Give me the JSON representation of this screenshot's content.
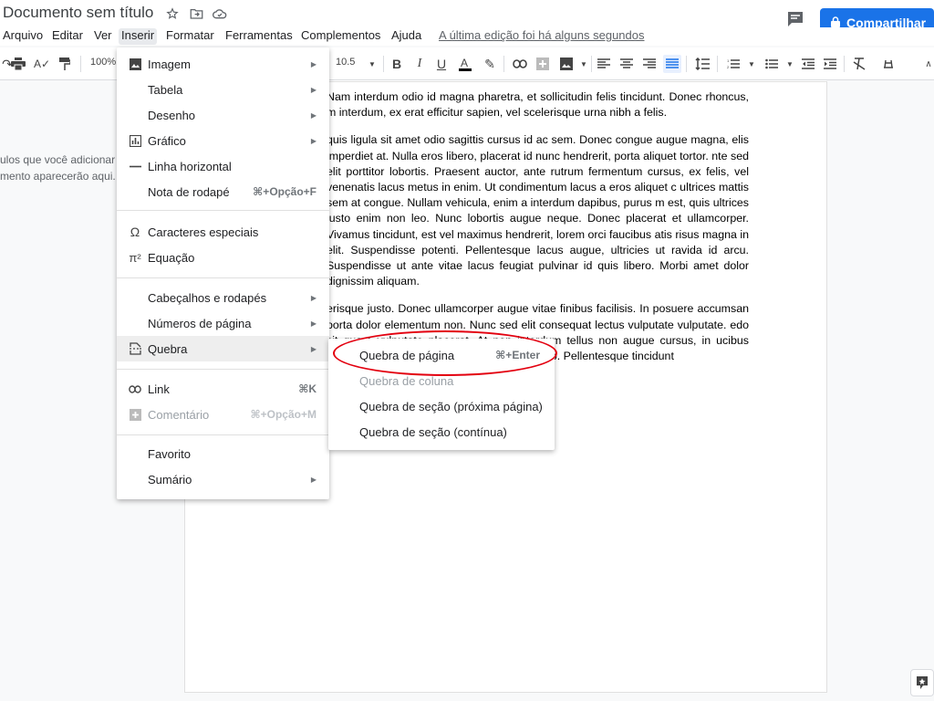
{
  "titlebar": {
    "doc_title": "Documento sem título",
    "share_label": "Compartilhar"
  },
  "menubar": {
    "items": [
      "Arquivo",
      "Editar",
      "Ver",
      "Inserir",
      "Formatar",
      "Ferramentas",
      "Complementos",
      "Ajuda"
    ],
    "active": "Inserir",
    "last_edit": "A última edição foi há alguns segundos"
  },
  "toolbar": {
    "zoom": "100%",
    "font_size": "10.5"
  },
  "outline": {
    "line1": "ulos que você adicionar a",
    "line2": "mento aparecerão aqui."
  },
  "insert_menu": {
    "items": [
      {
        "label": "Imagem",
        "icon": "image-icon",
        "shortcut": "",
        "submenu": true,
        "disabled": false
      },
      {
        "label": "Tabela",
        "icon": "",
        "shortcut": "",
        "submenu": true,
        "disabled": false
      },
      {
        "label": "Desenho",
        "icon": "",
        "shortcut": "",
        "submenu": true,
        "disabled": false
      },
      {
        "label": "Gráfico",
        "icon": "chart-icon",
        "shortcut": "",
        "submenu": true,
        "disabled": false
      },
      {
        "label": "Linha horizontal",
        "icon": "horizontal-line-icon",
        "shortcut": "",
        "submenu": false,
        "disabled": false
      },
      {
        "label": "Nota de rodapé",
        "icon": "",
        "shortcut": "⌘+Opção+F",
        "submenu": false,
        "disabled": false
      },
      {
        "label": "Caracteres especiais",
        "icon": "omega-icon",
        "shortcut": "",
        "submenu": false,
        "disabled": false
      },
      {
        "label": "Equação",
        "icon": "pi-icon",
        "shortcut": "",
        "submenu": false,
        "disabled": false
      },
      {
        "label": "Cabeçalhos e rodapés",
        "icon": "",
        "shortcut": "",
        "submenu": true,
        "disabled": false
      },
      {
        "label": "Números de página",
        "icon": "",
        "shortcut": "",
        "submenu": true,
        "disabled": false
      },
      {
        "label": "Quebra",
        "icon": "page-break-icon",
        "shortcut": "",
        "submenu": true,
        "disabled": false
      },
      {
        "label": "Link",
        "icon": "link-icon",
        "shortcut": "⌘K",
        "submenu": false,
        "disabled": false
      },
      {
        "label": "Comentário",
        "icon": "add-comment-icon",
        "shortcut": "⌘+Opção+M",
        "submenu": false,
        "disabled": true
      },
      {
        "label": "Favorito",
        "icon": "",
        "shortcut": "",
        "submenu": false,
        "disabled": false
      },
      {
        "label": "Sumário",
        "icon": "",
        "shortcut": "",
        "submenu": true,
        "disabled": false
      }
    ]
  },
  "break_submenu": {
    "items": [
      {
        "label": "Quebra de página",
        "shortcut": "⌘+Enter",
        "disabled": false
      },
      {
        "label": "Quebra de coluna",
        "shortcut": "",
        "disabled": true
      },
      {
        "label": "Quebra de seção (próxima página)",
        "shortcut": "",
        "disabled": false
      },
      {
        "label": "Quebra de seção (contínua)",
        "shortcut": "",
        "disabled": false
      }
    ]
  },
  "document": {
    "paragraphs": [
      "Nam interdum odio id magna pharetra, et sollicitudin felis tincidunt. Donec rhoncus, m interdum, ex erat efficitur sapien, vel scelerisque urna nibh a felis.",
      "quis ligula sit amet odio sagittis cursus id ac sem. Donec congue augue magna, elis imperdiet at. Nulla eros libero, placerat id nunc hendrerit, porta aliquet tortor. nte sed elit porttitor lobortis. Praesent auctor, ante rutrum fermentum cursus, ex felis, vel venenatis lacus metus in enim. Ut condimentum lacus a eros aliquet c ultrices mattis sem at congue. Nullam vehicula, enim a interdum dapibus, purus m est, quis ultrices justo enim non leo. Nunc lobortis augue neque. Donec placerat et ullamcorper. Vivamus tincidunt, est vel maximus hendrerit, lorem orci faucibus atis risus magna in elit. Suspendisse potenti. Pellentesque lacus augue, ultricies ut ravida id arcu. Suspendisse ut ante vitae lacus feugiat pulvinar id quis libero. Morbi amet dolor dignissim aliquam.",
      "erisque justo. Donec ullamcorper augue vitae finibus facilisis. In posuere accumsan porta dolor elementum non. Nunc sed elit consequat lectus vulputate vulputate. edo sit quam vulputate placerat. At non interdum tellus non augue cursus, in ucibus semper nunc sit amet aliquam. e eget vel odio. Pellentesque tincidunt"
    ]
  },
  "colors": {
    "accent": "#1a73e8",
    "highlight_circle": "#e3000f"
  }
}
